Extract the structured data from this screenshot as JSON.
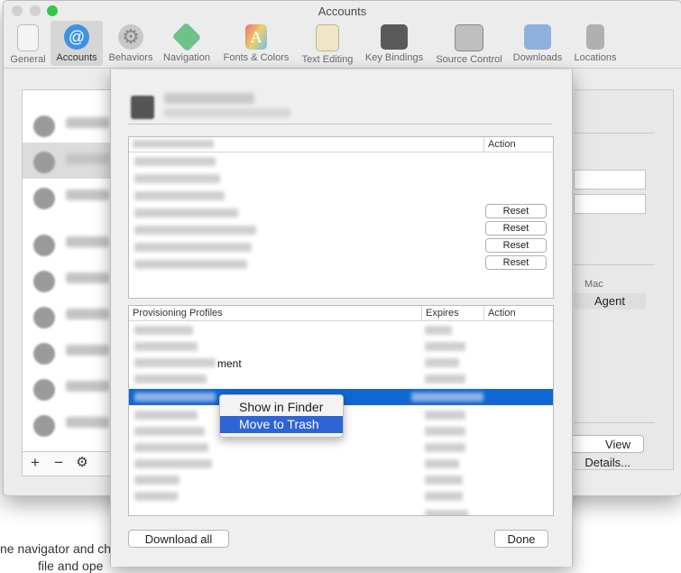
{
  "background_page": {
    "line1": "ne navigator and ch",
    "line2": "file and ope"
  },
  "window": {
    "title": "Accounts",
    "traffic_colors": [
      "#fc605c",
      "#fdbc40",
      "#34c84a"
    ]
  },
  "toolbar": {
    "items": [
      {
        "label": "General",
        "icon": "general-icon"
      },
      {
        "label": "Accounts",
        "icon": "at-sign-icon",
        "selected": true
      },
      {
        "label": "Behaviors",
        "icon": "gear-icon"
      },
      {
        "label": "Navigation",
        "icon": "navigation-icon"
      },
      {
        "label": "Fonts & Colors",
        "icon": "fonts-colors-icon"
      },
      {
        "label": "Text Editing",
        "icon": "text-editing-icon"
      },
      {
        "label": "Key Bindings",
        "icon": "key-bindings-icon"
      },
      {
        "label": "Source Control",
        "icon": "source-control-icon"
      },
      {
        "label": "Downloads",
        "icon": "downloads-icon"
      },
      {
        "label": "Locations",
        "icon": "locations-icon"
      }
    ]
  },
  "accounts_footer": {
    "add": "+",
    "remove": "−",
    "settings": "⚙"
  },
  "right_pane": {
    "mac_header": "Mac",
    "agent": "Agent",
    "view_details": "View Details..."
  },
  "signing": {
    "action_header": "Action",
    "reset_label": "Reset"
  },
  "profiles": {
    "header_name": "Provisioning Profiles",
    "header_expires": "Expires",
    "header_action": "Action",
    "partial_text": "ment"
  },
  "context_menu": {
    "show_in_finder": "Show in Finder",
    "move_to_trash": "Move to Trash"
  },
  "buttons": {
    "download_all": "Download all",
    "done": "Done"
  }
}
